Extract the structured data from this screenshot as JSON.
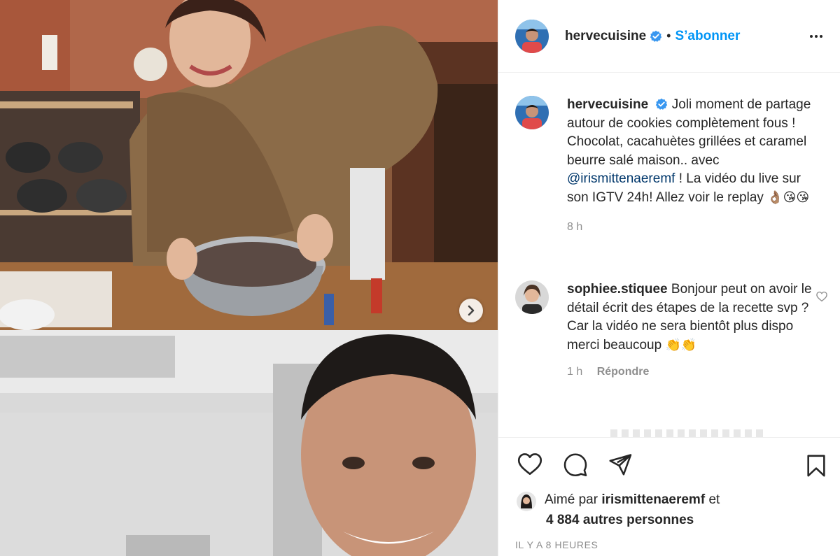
{
  "header": {
    "username": "hervecuisine",
    "separator": "•",
    "follow_label": "S’abonner",
    "more_icon": "more-horizontal-icon"
  },
  "caption": {
    "username": "hervecuisine",
    "text_before": "Joli moment de partage autour de cookies complètement fous ! Chocolat, cacahuètes grillées et caramel beurre salé maison.. avec",
    "mention": "@irismittenaeremf",
    "text_after": "! La vidéo du live sur son IGTV 24h! Allez voir le replay",
    "emojis": "👌🏽😘😘",
    "age": "8 h"
  },
  "comment": {
    "username": "sophiee.stiquee",
    "text": "Bonjour peut on avoir le détail écrit des étapes de la recette svp ? Car la vidéo ne sera bientôt plus dispo merci beaucoup",
    "emojis": "👏👏",
    "age": "1 h",
    "reply_label": "Répondre"
  },
  "likes": {
    "prefix": "Aimé par",
    "user": "irismittenaeremf",
    "joiner": "et",
    "others": "4 884 autres personnes"
  },
  "timestamp": "IL Y A 8 HEURES",
  "colors": {
    "accent": "#0095f6",
    "verified": "#3897f0",
    "mention": "#00376b",
    "muted": "#8e8e8e"
  }
}
